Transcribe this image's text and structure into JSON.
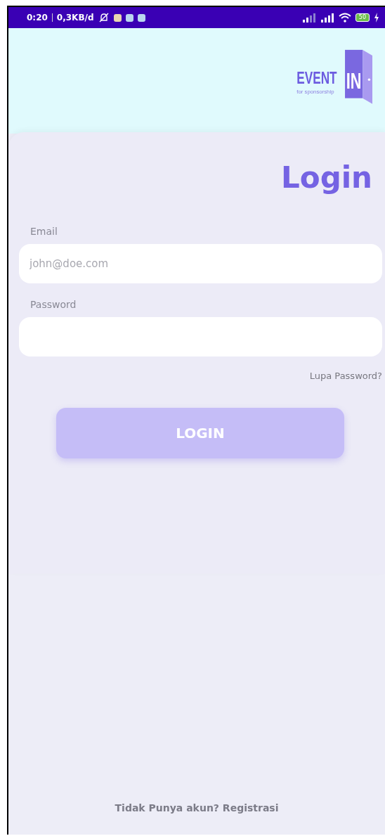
{
  "status_bar": {
    "time": "0:20",
    "data_rate": "0,3KB/d",
    "battery": "50"
  },
  "logo": {
    "word": "EVENT",
    "door_word": "IN",
    "tagline": "for sponsorship"
  },
  "title": "Login",
  "fields": [
    {
      "label": "Email",
      "placeholder": "john@doe.com"
    },
    {
      "label": "Password"
    }
  ],
  "forgot_link": "Lupa Password?",
  "login_button": "LOGIN",
  "register_prompt": "Tidak Punya akun? Registrasi"
}
